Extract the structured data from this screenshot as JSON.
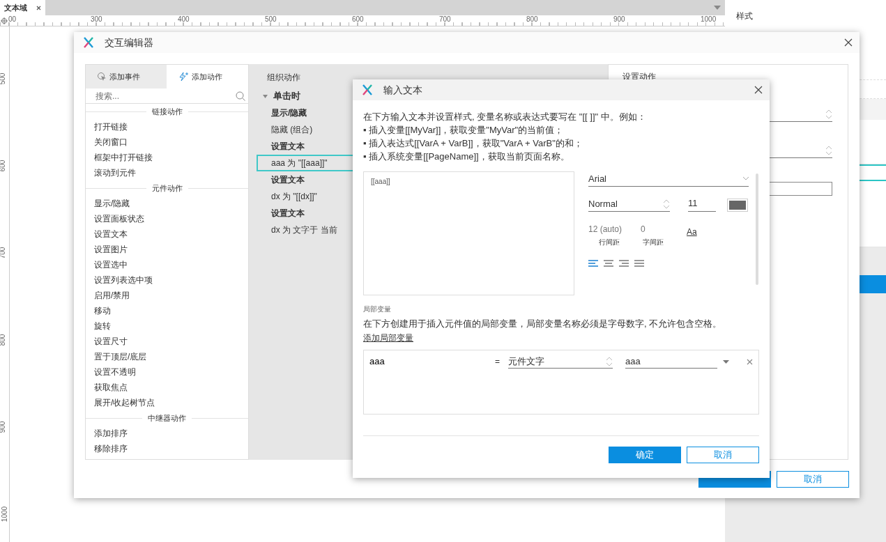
{
  "document_tab": {
    "label": "文本域"
  },
  "ruler": {
    "x_labels": [
      "00",
      "300",
      "400",
      "500",
      "600",
      "700",
      "800",
      "900",
      "1000"
    ],
    "y_labels": [
      "500",
      "600",
      "700",
      "800",
      "900",
      "1000"
    ]
  },
  "right_panel": {
    "title": "样式"
  },
  "interaction_editor": {
    "title": "交互编辑器",
    "tabs": [
      {
        "label": "添加事件",
        "kind": "event",
        "selected": false
      },
      {
        "label": "添加动作",
        "kind": "action",
        "selected": true
      }
    ],
    "search": {
      "placeholder": "搜索..."
    },
    "action_groups": [
      {
        "title": "链接动作",
        "items": [
          "打开链接",
          "关闭窗口",
          "框架中打开链接",
          "滚动到元件"
        ]
      },
      {
        "title": "元件动作",
        "items": [
          "显示/隐藏",
          "设置面板状态",
          "设置文本",
          "设置图片",
          "设置选中",
          "设置列表选中项",
          "启用/禁用",
          "移动",
          "旋转",
          "设置尺寸",
          "置于顶层/底层",
          "设置不透明",
          "获取焦点",
          "展开/收起树节点"
        ]
      },
      {
        "title": "中继器动作",
        "items": [
          "添加排序",
          "移除排序"
        ]
      }
    ],
    "organize_title": "组织动作",
    "event": {
      "label": "单击时",
      "expanded": true,
      "actions": [
        {
          "name": "显示/隐藏",
          "detail": "隐藏 (组合)",
          "selected": false
        },
        {
          "name": "设置文本",
          "detail": "aaa 为 \"[[aaa]]\"",
          "selected": true
        },
        {
          "name": "设置文本",
          "detail": "dx 为 \"[[dx]]\"",
          "selected": false
        },
        {
          "name": "设置文本",
          "detail": "dx 为 文字于 当前",
          "selected": false
        }
      ]
    },
    "settings_title": "设置动作",
    "buttons": [
      {
        "kind": "primary"
      },
      {
        "label": "取消",
        "kind": "secondary"
      }
    ]
  },
  "input_text_dialog": {
    "title": "输入文本",
    "instructions": [
      "在下方输入文本并设置样式, 变量名称或表达式要写在 \"[[ ]]\" 中。例如：",
      "▪ 插入变量[[MyVar]]，获取变量\"MyVar\"的当前值；",
      "▪ 插入表达式[[VarA + VarB]]，获取\"VarA + VarB\"的和；",
      "▪ 插入系统变量[[PageName]]，获取当前页面名称。"
    ],
    "text_value": "[[aaa]]",
    "font": "Arial",
    "weight": "Normal",
    "size": "11",
    "line_spacing": {
      "placeholder": "12 (auto)",
      "label": "行间距"
    },
    "letter_spacing": {
      "placeholder": "0",
      "label": "字间距"
    },
    "case_button": "Aa",
    "alignments": [
      {
        "kind": "left",
        "selected": true
      },
      {
        "kind": "center",
        "selected": false
      },
      {
        "kind": "right",
        "selected": false
      },
      {
        "kind": "justify",
        "selected": false
      }
    ],
    "local_vars_title": "局部变量",
    "local_vars_hint": "在下方创建用于插入元件值的局部变量，局部变量名称必须是字母数字, 不允许包含空格。",
    "add_link": "添加局部变量",
    "variables": [
      {
        "name": "aaa",
        "equals": "=",
        "type": "元件文字",
        "target": "aaa"
      }
    ],
    "buttons": [
      {
        "label": "确定",
        "kind": "primary"
      },
      {
        "label": "取消",
        "kind": "secondary"
      }
    ]
  }
}
